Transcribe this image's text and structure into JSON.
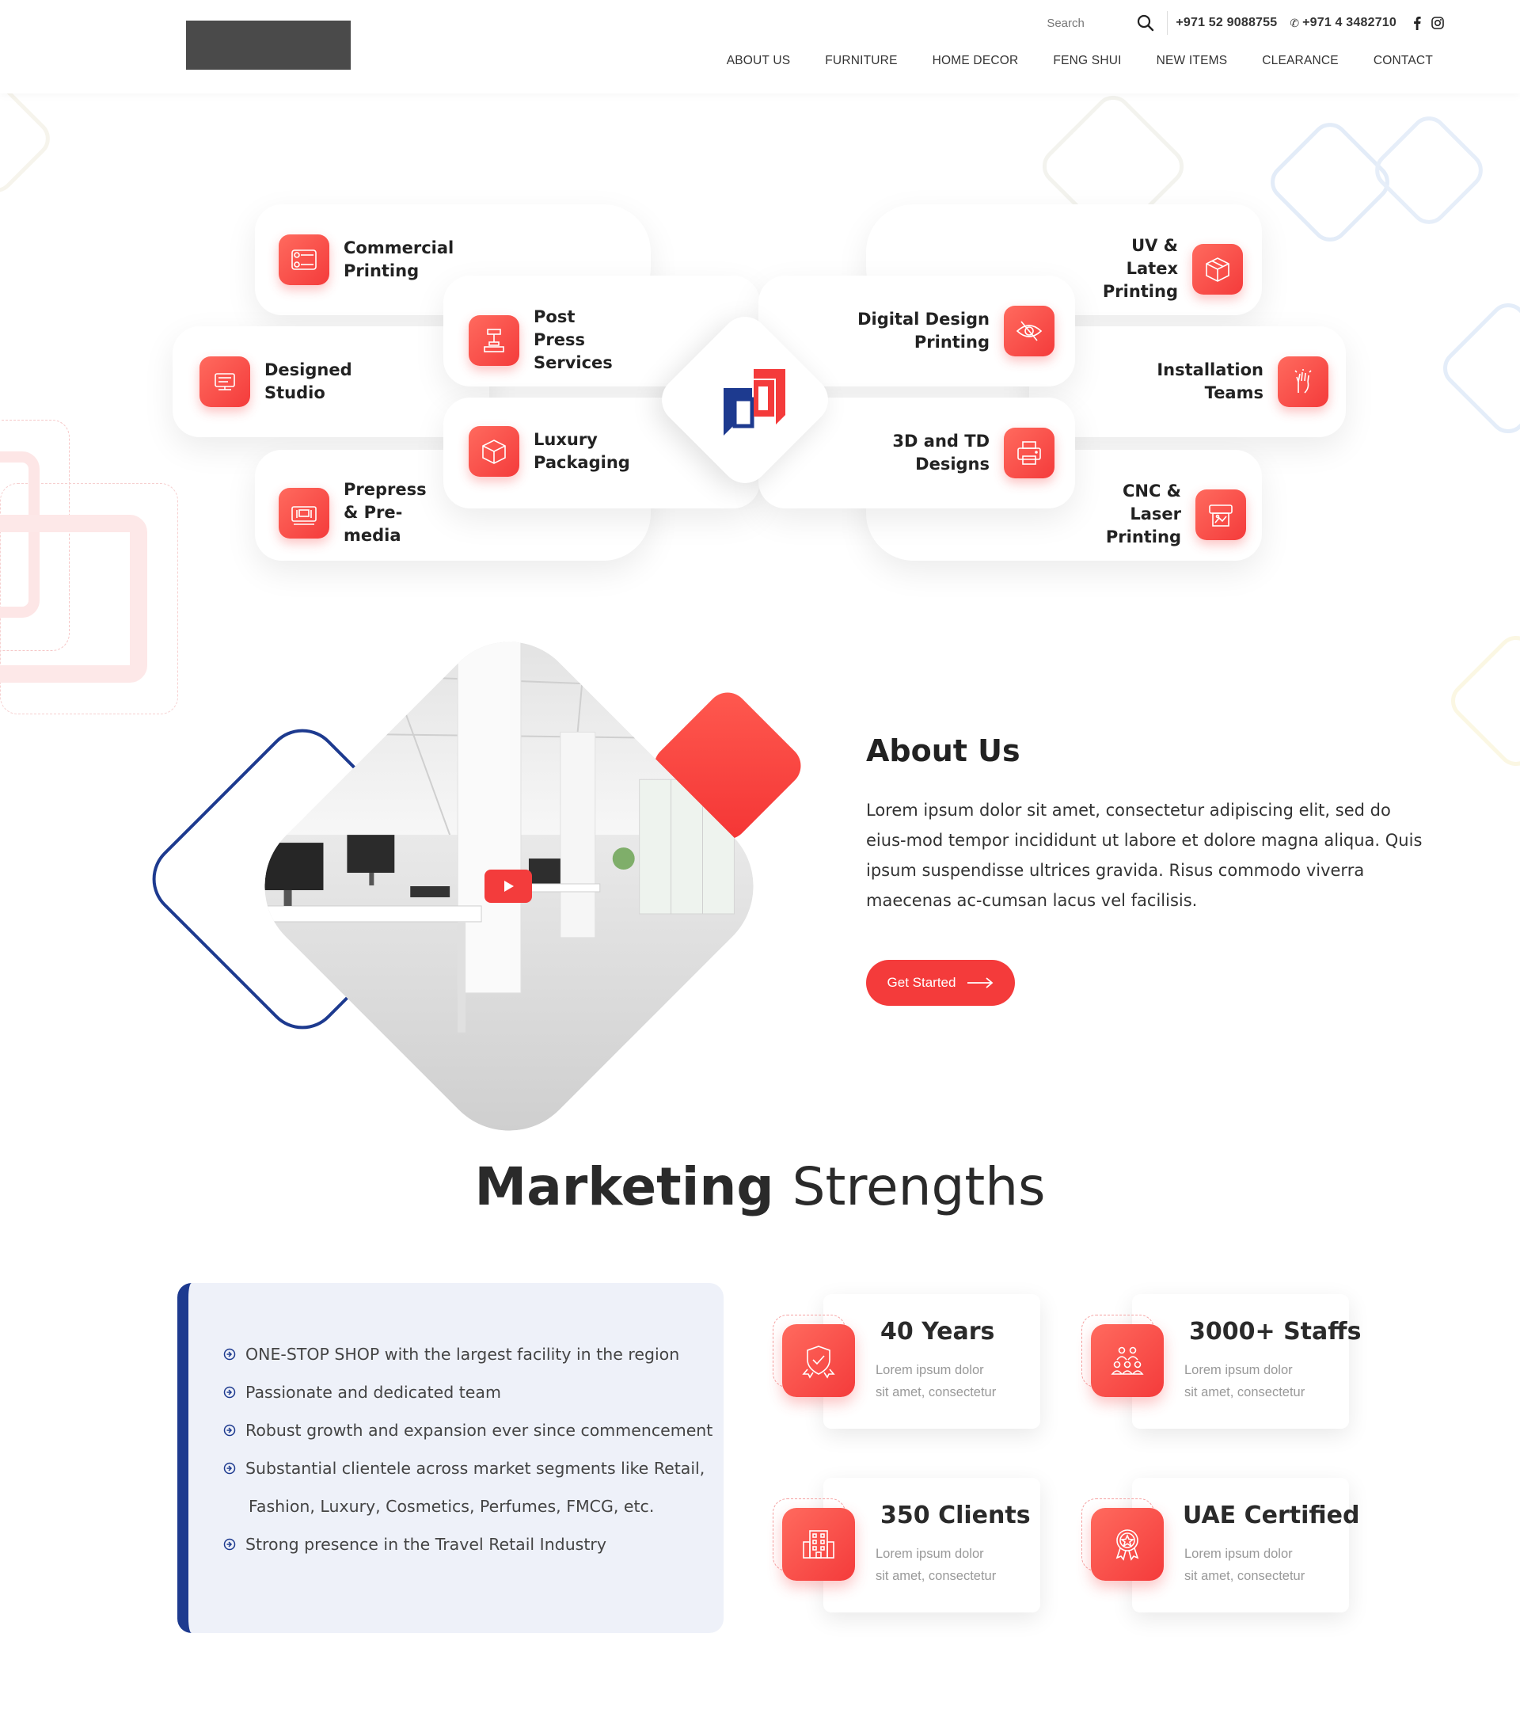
{
  "header": {
    "search_placeholder": "Search",
    "phone1": "+971 52 9088755",
    "phone2": "+971 4 3482710",
    "nav": [
      "ABOUT US",
      "FURNITURE",
      "HOME DECOR",
      "FENG SHUI",
      "NEW ITEMS",
      "CLEARANCE",
      "CONTACT"
    ]
  },
  "services": {
    "left": [
      {
        "label": "Commercial Printing",
        "icon": "printer-rolls-icon"
      },
      {
        "label": "Designed Studio",
        "icon": "design-studio-icon"
      },
      {
        "label": "Prepress & Pre-media",
        "icon": "prepress-machine-icon"
      }
    ],
    "inner_left": [
      {
        "label": "Post Press Services",
        "icon": "press-icon"
      },
      {
        "label": "Luxury Packaging",
        "icon": "box-icon"
      }
    ],
    "inner_right": [
      {
        "label": "Digital Design Printing",
        "icon": "eye-target-icon"
      },
      {
        "label": "3D and TD Designs",
        "icon": "printer-icon"
      }
    ],
    "right": [
      {
        "label": "UV & Latex Printing",
        "icon": "cube-package-icon"
      },
      {
        "label": "Installation Teams",
        "icon": "raised-hand-icon"
      },
      {
        "label": "CNC & Laser Printing",
        "icon": "laser-printer-icon"
      }
    ]
  },
  "about": {
    "title": "About Us",
    "text": "Lorem ipsum dolor sit amet, consectetur adipiscing elit, sed do eius-mod tempor incididunt ut labore et dolore magna aliqua. Quis ipsum suspendisse ultrices gravida. Risus commodo viverra maecenas ac-cumsan lacus vel facilisis.",
    "button_label": "Get Started"
  },
  "marketing": {
    "title_bold": "Marketing",
    "title_light": "Strengths",
    "list": [
      "ONE-STOP SHOP with the largest facility in the region",
      "Passionate and dedicated team",
      "Robust growth and expansion ever since commencement",
      "Substantial clientele across market segments like Retail,",
      "Fashion, Luxury, Cosmetics, Perfumes, FMCG, etc.",
      "Strong presence in the Travel Retail Industry"
    ],
    "stats": [
      {
        "title": "40 Years",
        "desc1": "Lorem ipsum dolor",
        "desc2": "sit amet, consectetur",
        "icon": "shield-badge-icon"
      },
      {
        "title": "3000+ Staffs",
        "desc1": "Lorem ipsum dolor",
        "desc2": "sit amet, consectetur",
        "icon": "team-icon"
      },
      {
        "title": "350 Clients",
        "desc1": "Lorem ipsum dolor",
        "desc2": "sit amet, consectetur",
        "icon": "building-icon"
      },
      {
        "title": "UAE Certified",
        "desc1": "Lorem ipsum dolor",
        "desc2": "sit amet, consectetur",
        "icon": "award-medal-icon"
      }
    ]
  },
  "colors": {
    "accent": "#f43b3b",
    "brand_blue": "#1d3a8f",
    "list_bg": "#eef1f9"
  }
}
